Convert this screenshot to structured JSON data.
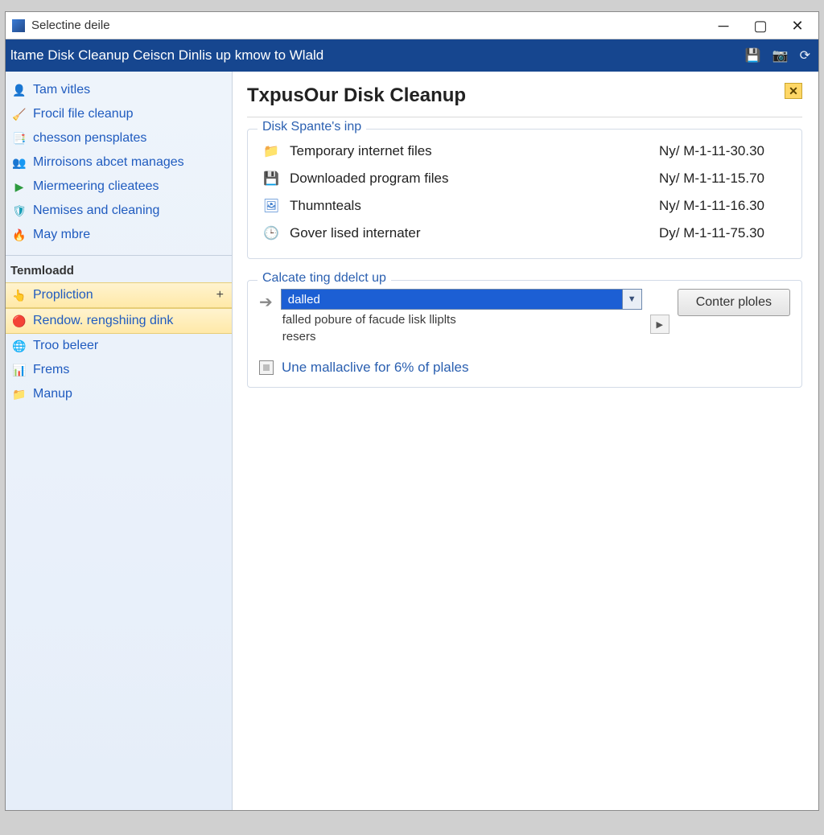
{
  "window": {
    "title": "Selectine deile"
  },
  "ribbon": {
    "text": "ltame Disk Cleanup Ceiscn Dinlis up kmow to Wlald"
  },
  "sidebar": {
    "items": [
      {
        "label": "Tam vitles"
      },
      {
        "label": "Frocil file cleanup"
      },
      {
        "label": "chesson pensplates"
      },
      {
        "label": "Mirroisons abcet manages"
      },
      {
        "label": "Miermeering clieatees"
      },
      {
        "label": "Nemises and cleaning"
      },
      {
        "label": "May mbre"
      }
    ],
    "section": "Tenmloadd",
    "items2": [
      {
        "label": "Propliction"
      },
      {
        "label": "Rendow. rengshiing dink"
      },
      {
        "label": "Troo beleer"
      },
      {
        "label": "Frems"
      },
      {
        "label": "Manup"
      }
    ]
  },
  "main": {
    "title": "TxpusOur Disk Cleanup",
    "group1": {
      "legend": "Disk Spante's inp",
      "rows": [
        {
          "name": "Temporary internet files",
          "size": "Ny/ M-1-11-30.30"
        },
        {
          "name": "Downloaded program files",
          "size": "Ny/ M-1-11-15.70"
        },
        {
          "name": "Thumnteals",
          "size": "Ny/ M-1-11-16.30"
        },
        {
          "name": "Gover lised internater",
          "size": "Dy/ M-1-11-75.30"
        }
      ]
    },
    "group2": {
      "legend": "Calcate ting ddelct up",
      "combo_value": "dalled",
      "combo_desc1": "falled pobure of facude lisk lliplts",
      "combo_desc2": "resers",
      "button": "Conter ploles",
      "checkbox_label": "Une mallaclive for 6% of plales"
    }
  }
}
